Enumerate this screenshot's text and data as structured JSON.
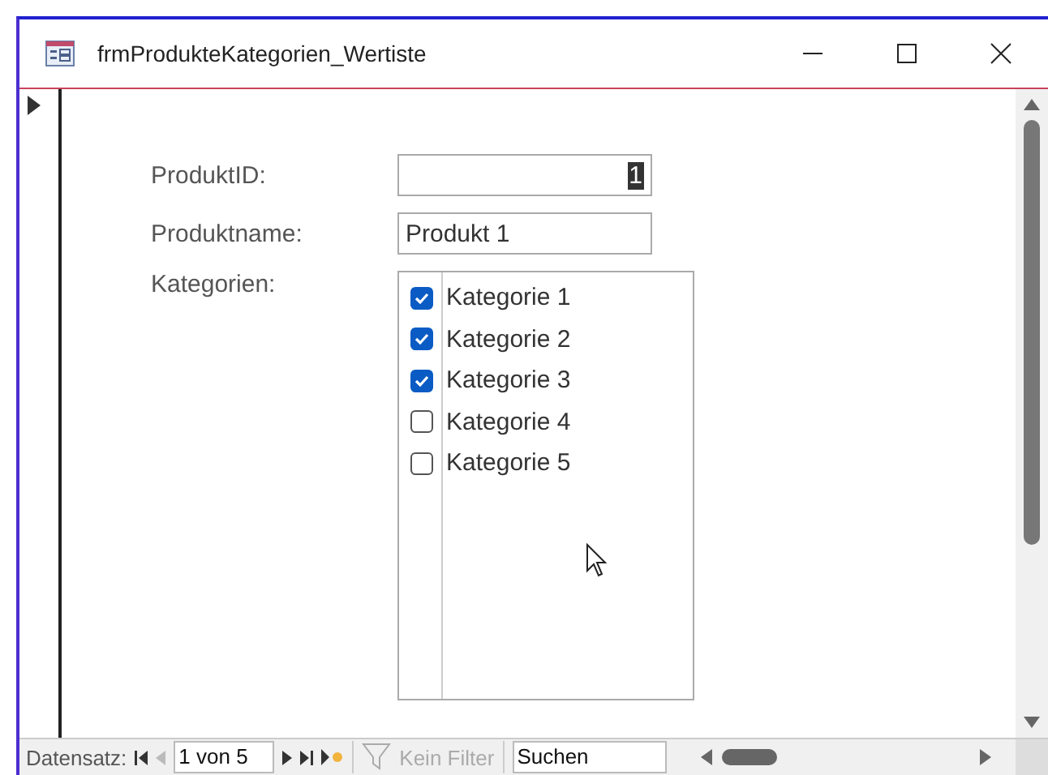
{
  "window": {
    "title": "frmProdukteKategorien_Wertiste"
  },
  "form": {
    "fields": [
      {
        "label": "ProduktID:",
        "value": "1",
        "kind": "number"
      },
      {
        "label": "Produktname:",
        "value": "Produkt 1",
        "kind": "text"
      }
    ],
    "list_label": "Kategorien:",
    "categories": [
      {
        "label": "Kategorie 1",
        "checked": true
      },
      {
        "label": "Kategorie 2",
        "checked": true
      },
      {
        "label": "Kategorie 3",
        "checked": true
      },
      {
        "label": "Kategorie 4",
        "checked": false
      },
      {
        "label": "Kategorie 5",
        "checked": false
      }
    ]
  },
  "navigation": {
    "label": "Datensatz:",
    "record": "1 von 5",
    "filter": "Kein Filter",
    "search": "Suchen"
  }
}
